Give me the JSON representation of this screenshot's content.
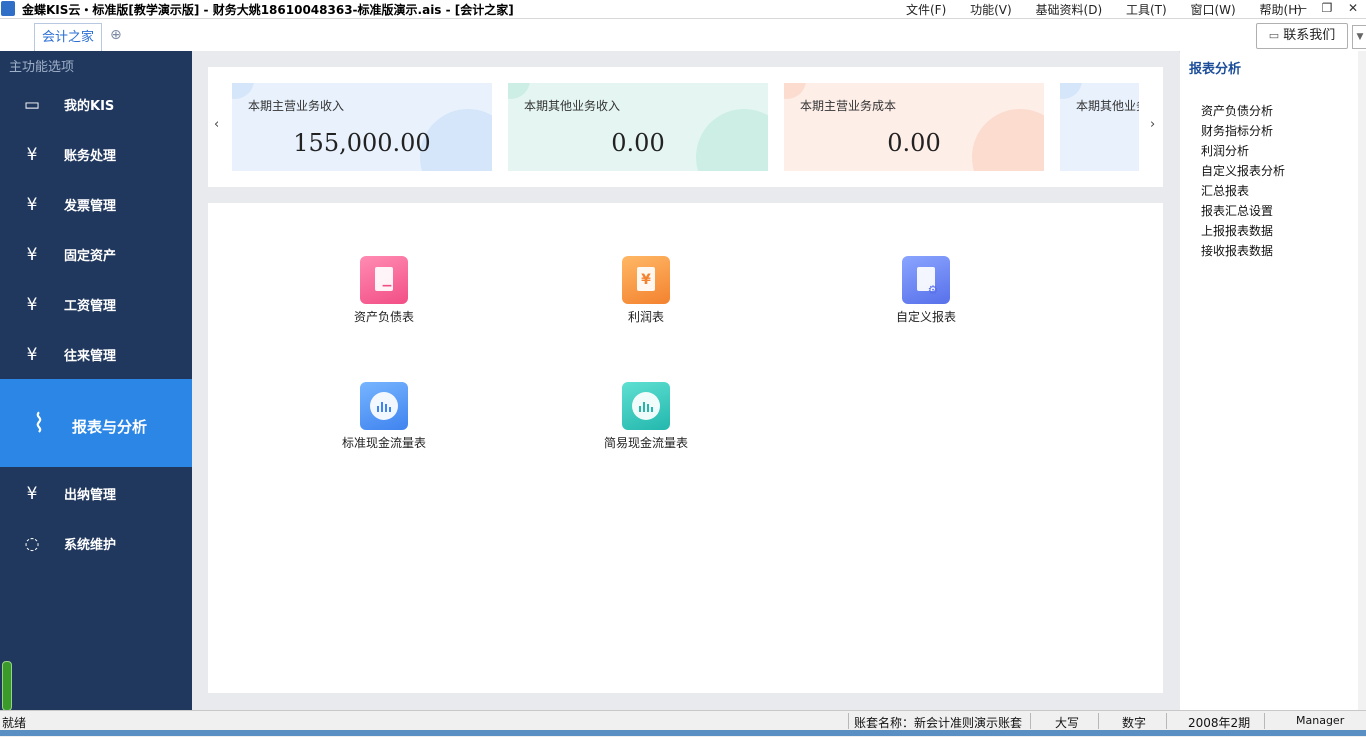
{
  "titlebar": {
    "title": "金蝶KIS云・标准版[教学演示版] - 财务大姚18610048363-标准版演示.ais - [会计之家]",
    "menus": [
      "文件(F)",
      "功能(V)",
      "基础资料(D)",
      "工具(T)",
      "窗口(W)",
      "帮助(H)"
    ],
    "min_glyph": "—",
    "restore_glyph": "❐",
    "close_glyph": "✕"
  },
  "tabbar": {
    "tab_label": "会计之家",
    "add_glyph": "⊕",
    "contact_label": "联系我们",
    "contact_icon": "chat-icon",
    "contact_glyph": "▭",
    "drop_glyph": "▼"
  },
  "sidebar": {
    "header": "主功能选项",
    "items": [
      {
        "label": "我的KIS",
        "icon": "monitor-icon",
        "glyph": "▭"
      },
      {
        "label": "账务处理",
        "icon": "yuan-shield-icon",
        "glyph": "¥"
      },
      {
        "label": "发票管理",
        "icon": "invoice-icon",
        "glyph": "¥"
      },
      {
        "label": "固定资产",
        "icon": "house-yuan-icon",
        "glyph": "¥"
      },
      {
        "label": "工资管理",
        "icon": "wage-icon",
        "glyph": "¥"
      },
      {
        "label": "往来管理",
        "icon": "exchange-icon",
        "glyph": "¥"
      },
      {
        "label": "报表与分析",
        "icon": "chart-board-icon",
        "glyph": "⌇"
      },
      {
        "label": "出纳管理",
        "icon": "cashier-icon",
        "glyph": "¥"
      },
      {
        "label": "系统维护",
        "icon": "cycle-icon",
        "glyph": "◌"
      }
    ]
  },
  "kpis": {
    "prev_glyph": "‹",
    "next_glyph": "›",
    "cards": [
      {
        "label": "本期主营业务收入",
        "value": "155,000.00",
        "bg": "#e8f1fc",
        "accent": "#d5e6fa"
      },
      {
        "label": "本期其他业务收入",
        "value": "0.00",
        "bg": "#e5f6f2",
        "accent": "#cdeee4"
      },
      {
        "label": "本期主营业务成本",
        "value": "0.00",
        "bg": "#fdeee8",
        "accent": "#fbdccf"
      },
      {
        "label": "本期其他业务成本",
        "value": "",
        "bg": "#e8f1fc",
        "accent": "#d5e6fa"
      }
    ]
  },
  "reports": [
    {
      "label": "资产负债表",
      "icon": "balance-sheet-icon",
      "color_from": "#ff8cb3",
      "color_to": "#f24e86",
      "glyph": "−"
    },
    {
      "label": "利润表",
      "icon": "income-statement-icon",
      "color_from": "#ffb866",
      "color_to": "#f3822f",
      "glyph": "¥"
    },
    {
      "label": "自定义报表",
      "icon": "custom-report-icon",
      "color_from": "#8aa5ff",
      "color_to": "#5870ea",
      "glyph": "⚙"
    },
    {
      "label": "标准现金流量表",
      "icon": "cashflow-standard-icon",
      "color_from": "#77b5ff",
      "color_to": "#3f83ef",
      "glyph": ""
    },
    {
      "label": "简易现金流量表",
      "icon": "cashflow-simple-icon",
      "color_from": "#5fe0d2",
      "color_to": "#23b7ad",
      "glyph": ""
    }
  ],
  "right_panel": {
    "title": "报表分析",
    "links": [
      "资产负债分析",
      "财务指标分析",
      "利润分析",
      "自定义报表分析",
      "汇总报表",
      "报表汇总设置",
      "上报报表数据",
      "接收报表数据"
    ]
  },
  "statusbar": {
    "ready": "就绪",
    "account": "账套名称：新会计准则演示账套",
    "caps": "大写",
    "num": "数字",
    "period": "2008年2期",
    "user": "Manager"
  }
}
